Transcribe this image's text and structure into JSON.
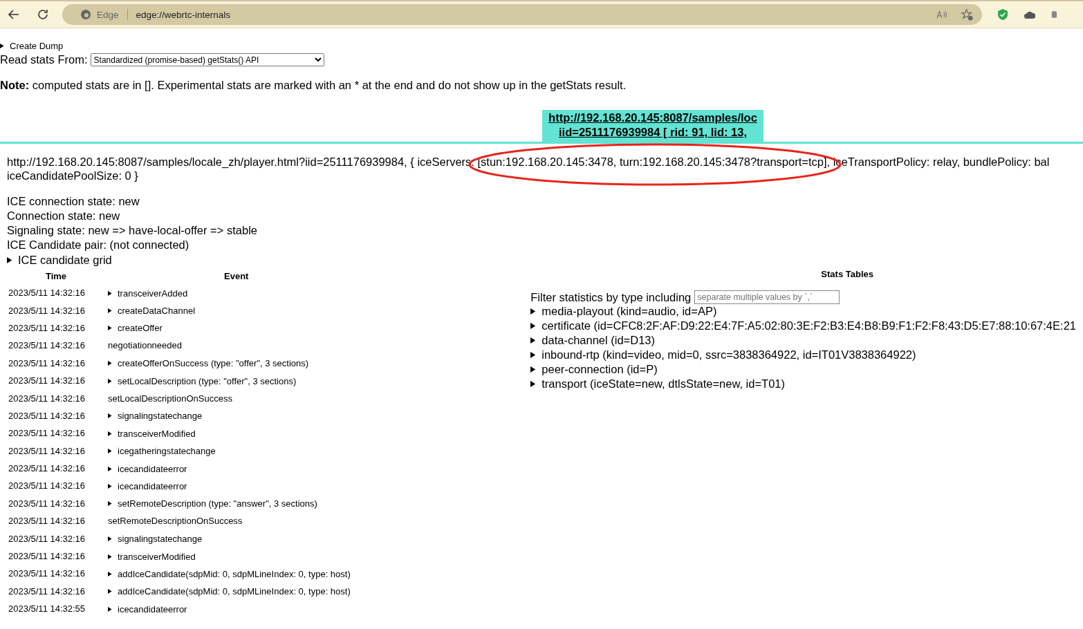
{
  "browser": {
    "site_label": "Edge",
    "url": "edge://webrtc-internals"
  },
  "create_dump": {
    "label": "Create Dump",
    "expanded": false
  },
  "read_stats": {
    "label": "Read stats From:",
    "value": "Standardized (promise-based) getStats() API"
  },
  "note": "**Note:** computed stats are in []. Experimental stats are marked with an * at the end and do not show up in the getStats result.",
  "tab": {
    "lines": [
      "http://192.168.20.145:8087/samples/loc",
      "iid=2511176939984 [ rid: 91, lid: 13,"
    ],
    "selected": true
  },
  "connection": {
    "line_1_before": "http://192.168.20.145:8087/samples/locale_zh/player.html?iid=2511176939984, { iceServers: ",
    "line_1_marked": "[stun:192.168.20.145:3478, turn:192.168.20.145:3478?transport=tcp]",
    "line_1_after": ", iceTransportPolicy: relay, bundlePolicy: bal",
    "line_2": "iceCandidatePoolSize: 0 }",
    "annotation": {
      "kind": "ellipse"
    }
  },
  "states": [
    "ICE connection state: new",
    "Connection state: new",
    "Signaling state: new => have-local-offer => stable",
    "ICE Candidate pair: (not connected)"
  ],
  "candidate_grid": {
    "label": "ICE candidate grid",
    "expanded": false
  },
  "events": {
    "columns": [
      "Time",
      "Event"
    ],
    "rows": [
      {
        "time": "2023/5/11 14:32:16",
        "event": "transceiverAdded",
        "expandable": true
      },
      {
        "time": "2023/5/11 14:32:16",
        "event": "createDataChannel",
        "expandable": true
      },
      {
        "time": "2023/5/11 14:32:16",
        "event": "createOffer",
        "expandable": true
      },
      {
        "time": "2023/5/11 14:32:16",
        "event": "negotiationneeded",
        "expandable": false
      },
      {
        "time": "2023/5/11 14:32:16",
        "event": "createOfferOnSuccess (type: \"offer\", 3 sections)",
        "expandable": true
      },
      {
        "time": "2023/5/11 14:32:16",
        "event": "setLocalDescription (type: \"offer\", 3 sections)",
        "expandable": true
      },
      {
        "time": "2023/5/11 14:32:16",
        "event": "setLocalDescriptionOnSuccess",
        "expandable": false
      },
      {
        "time": "2023/5/11 14:32:16",
        "event": "signalingstatechange",
        "expandable": true
      },
      {
        "time": "2023/5/11 14:32:16",
        "event": "transceiverModified",
        "expandable": true
      },
      {
        "time": "2023/5/11 14:32:16",
        "event": "icegatheringstatechange",
        "expandable": true
      },
      {
        "time": "2023/5/11 14:32:16",
        "event": "icecandidateerror",
        "expandable": true
      },
      {
        "time": "2023/5/11 14:32:16",
        "event": "icecandidateerror",
        "expandable": true
      },
      {
        "time": "2023/5/11 14:32:16",
        "event": "setRemoteDescription (type: \"answer\", 3 sections)",
        "expandable": true
      },
      {
        "time": "2023/5/11 14:32:16",
        "event": "setRemoteDescriptionOnSuccess",
        "expandable": false
      },
      {
        "time": "2023/5/11 14:32:16",
        "event": "signalingstatechange",
        "expandable": true
      },
      {
        "time": "2023/5/11 14:32:16",
        "event": "transceiverModified",
        "expandable": true
      },
      {
        "time": "2023/5/11 14:32:16",
        "event": "addIceCandidate(sdpMid: 0, sdpMLineIndex: 0, type: host)",
        "expandable": true
      },
      {
        "time": "2023/5/11 14:32:16",
        "event": "addIceCandidate(sdpMid: 0, sdpMLineIndex: 0, type: host)",
        "expandable": true
      },
      {
        "time": "2023/5/11 14:32:55",
        "event": "icecandidateerror",
        "expandable": true
      }
    ]
  },
  "stats": {
    "title": "Stats Tables",
    "filter_label": "Filter statistics by type including",
    "filter_placeholder": "separate multiple values by `,`",
    "items": [
      {
        "label": "media-playout (kind=audio, id=AP)",
        "expanded": false
      },
      {
        "label": "certificate (id=CFC8:2F:AF:D9:22:E4:7F:A5:02:80:3E:F2:B3:E4:B8:B9:F1:F2:F8:43:D5:E7:88:10:67:4E:21",
        "expanded": false
      },
      {
        "label": "data-channel (id=D13)",
        "expanded": false
      },
      {
        "label": "inbound-rtp (kind=video, mid=0, ssrc=3838364922, id=IT01V3838364922)",
        "expanded": false
      },
      {
        "label": "peer-connection (id=P)",
        "expanded": false
      },
      {
        "label": "transport (iceState=new, dtlsState=new, id=T01)",
        "expanded": false
      }
    ]
  }
}
